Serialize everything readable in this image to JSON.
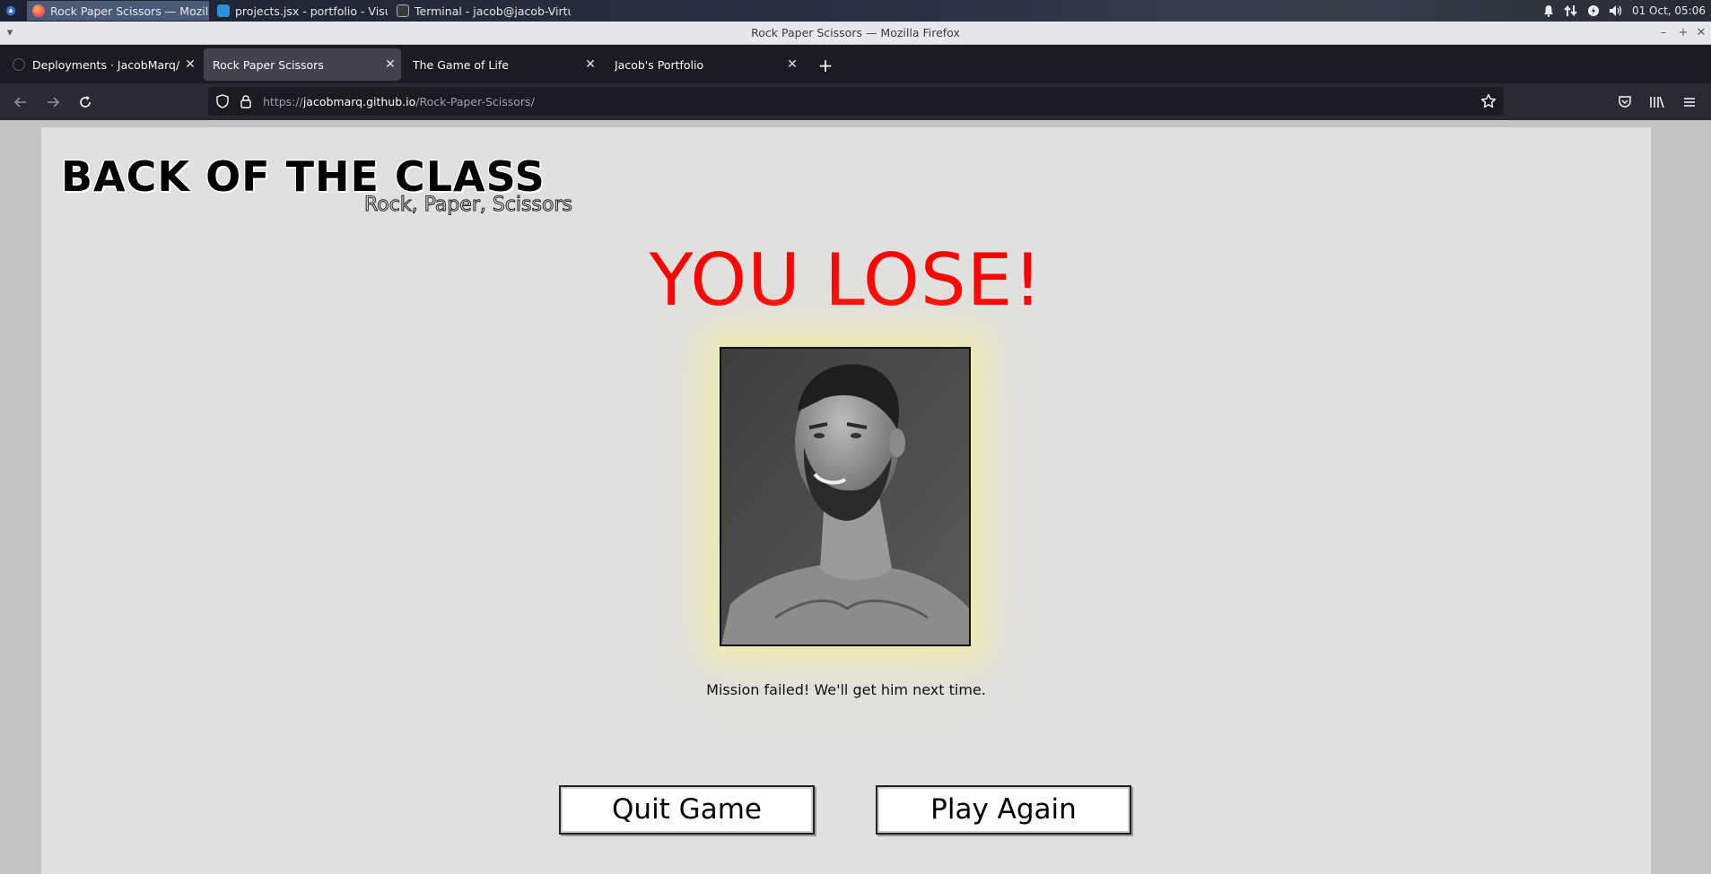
{
  "taskbar": {
    "apps": [
      {
        "label": "Rock Paper Scissors — Mozil...",
        "icon": "firefox-icon",
        "active": true
      },
      {
        "label": "projects.jsx - portfolio - Visua...",
        "icon": "vscode-icon",
        "active": false
      },
      {
        "label": "Terminal - jacob@jacob-Virtu...",
        "icon": "terminal-icon",
        "active": false
      }
    ],
    "clock": "01 Oct, 05:06"
  },
  "window": {
    "title": "Rock Paper Scissors — Mozilla Firefox"
  },
  "tabs": [
    {
      "label": "Deployments · JacobMarq/Rock-Paper-Scissors",
      "selected": false
    },
    {
      "label": "Rock Paper Scissors",
      "selected": true
    },
    {
      "label": "The Game of Life",
      "selected": false
    },
    {
      "label": "Jacob's Portfolio",
      "selected": false
    }
  ],
  "urlbar": {
    "scheme": "https://",
    "host": "jacobmarq.github.io",
    "path": "/Rock-Paper-Scissors/"
  },
  "page": {
    "site_title": "BACK OF THE CLASS",
    "site_subtitle": "Rock, Paper, Scissors",
    "result_heading": "YOU LOSE!",
    "result_message": "Mission failed! We'll get him next time.",
    "quit_label": "Quit Game",
    "play_again_label": "Play Again"
  },
  "colors": {
    "result_heading": "#ff0000",
    "page_background": "#e0e0e0",
    "portrait_glow": "#f6f096"
  }
}
